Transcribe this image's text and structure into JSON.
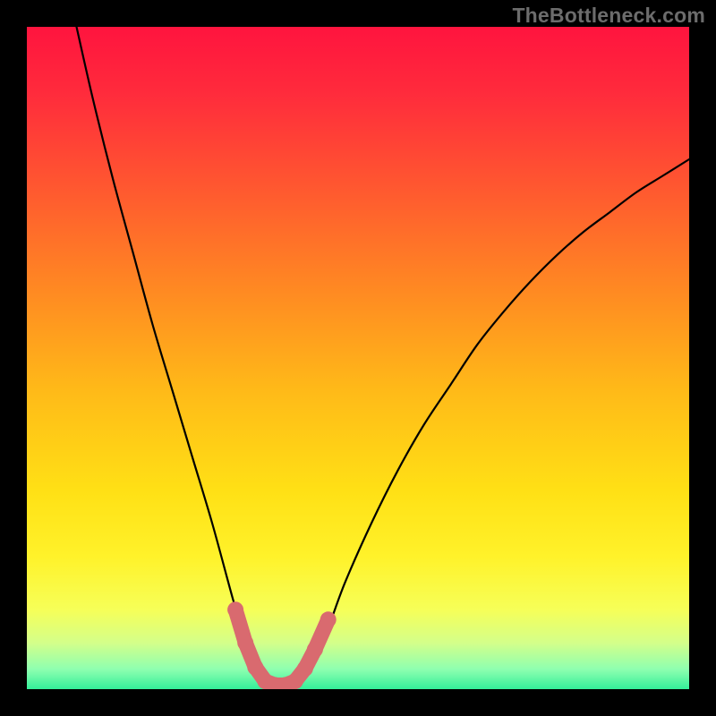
{
  "watermark": "TheBottleneck.com",
  "colors": {
    "frame": "#000000",
    "curve": "#000000",
    "highlight": "#d96a6f",
    "gradient_stops": [
      {
        "offset": 0.0,
        "color": "#ff143e"
      },
      {
        "offset": 0.1,
        "color": "#ff2b3c"
      },
      {
        "offset": 0.25,
        "color": "#ff5a2f"
      },
      {
        "offset": 0.4,
        "color": "#ff8a22"
      },
      {
        "offset": 0.55,
        "color": "#ffba18"
      },
      {
        "offset": 0.7,
        "color": "#ffe015"
      },
      {
        "offset": 0.8,
        "color": "#fff22a"
      },
      {
        "offset": 0.88,
        "color": "#f6ff58"
      },
      {
        "offset": 0.93,
        "color": "#d4ff8a"
      },
      {
        "offset": 0.97,
        "color": "#8effb0"
      },
      {
        "offset": 1.0,
        "color": "#34ef9a"
      }
    ]
  },
  "chart_data": {
    "type": "line",
    "title": "",
    "xlabel": "",
    "ylabel": "",
    "xlim": [
      0,
      100
    ],
    "ylim": [
      0,
      100
    ],
    "series": [
      {
        "name": "bottleneck-curve",
        "x": [
          7.5,
          10,
          13,
          16,
          19,
          22,
          25,
          28,
          31,
          32.5,
          34,
          35.5,
          37,
          38.5,
          40,
          42,
          45,
          48,
          52,
          56,
          60,
          64,
          68,
          72,
          76,
          80,
          84,
          88,
          92,
          96,
          100
        ],
        "y": [
          100,
          89,
          77,
          66,
          55,
          45,
          35,
          25,
          14,
          9,
          5,
          2,
          0.7,
          0.5,
          0.7,
          2,
          8,
          16,
          25,
          33,
          40,
          46,
          52,
          57,
          61.5,
          65.5,
          69,
          72,
          75,
          77.5,
          80
        ]
      }
    ],
    "highlight_region": {
      "name": "optimal-range-markers",
      "points": [
        {
          "x": 31.5,
          "y": 12
        },
        {
          "x": 33.0,
          "y": 7
        },
        {
          "x": 34.5,
          "y": 3.3
        },
        {
          "x": 36.0,
          "y": 1.2
        },
        {
          "x": 37.5,
          "y": 0.6
        },
        {
          "x": 39.0,
          "y": 0.6
        },
        {
          "x": 40.5,
          "y": 1.2
        },
        {
          "x": 42.0,
          "y": 3.1
        },
        {
          "x": 43.5,
          "y": 6.0
        },
        {
          "x": 45.5,
          "y": 10.5
        }
      ]
    }
  }
}
